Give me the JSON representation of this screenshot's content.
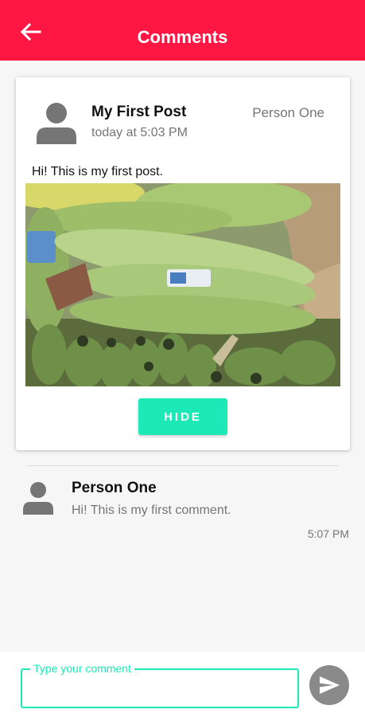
{
  "appbar": {
    "title": "Comments",
    "back_icon": "arrow-left-icon",
    "color": "#ff1744"
  },
  "post": {
    "title": "My First Post",
    "time": "today at 5:03 PM",
    "author": "Person One",
    "text": "Hi! This is my first post.",
    "avatar_icon": "person-icon",
    "image_subject": "bananas in box",
    "hide_label": "HIDE"
  },
  "comments": [
    {
      "author": "Person One",
      "text": "Hi! This is my first comment.",
      "time": "5:07 PM",
      "avatar_icon": "person-icon"
    }
  ],
  "composer": {
    "placeholder": "Type your comment",
    "send_icon": "send-icon",
    "accent": "#1de9b6"
  }
}
